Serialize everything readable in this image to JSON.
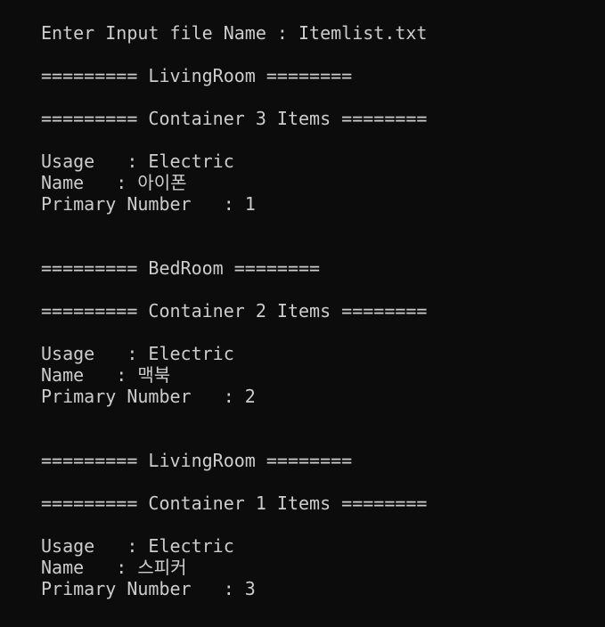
{
  "console": {
    "lines": [
      "Enter Input file Name : Itemlist.txt",
      "========= LivingRoom ========",
      "========= Container 3 Items ========",
      "Usage   : Electric",
      "Name   : 아이폰",
      "Primary Number   : 1",
      "========= BedRoom ========",
      "========= Container 2 Items ========",
      "Usage   : Electric",
      "Name   : 맥북",
      "Primary Number   : 2",
      "========= LivingRoom ========",
      "========= Container 1 Items ========",
      "Usage   : Electric",
      "Name   : 스피커",
      "Primary Number   : 3"
    ]
  },
  "colors": {
    "background": "#0c0c0c",
    "text": "#cccccc"
  }
}
